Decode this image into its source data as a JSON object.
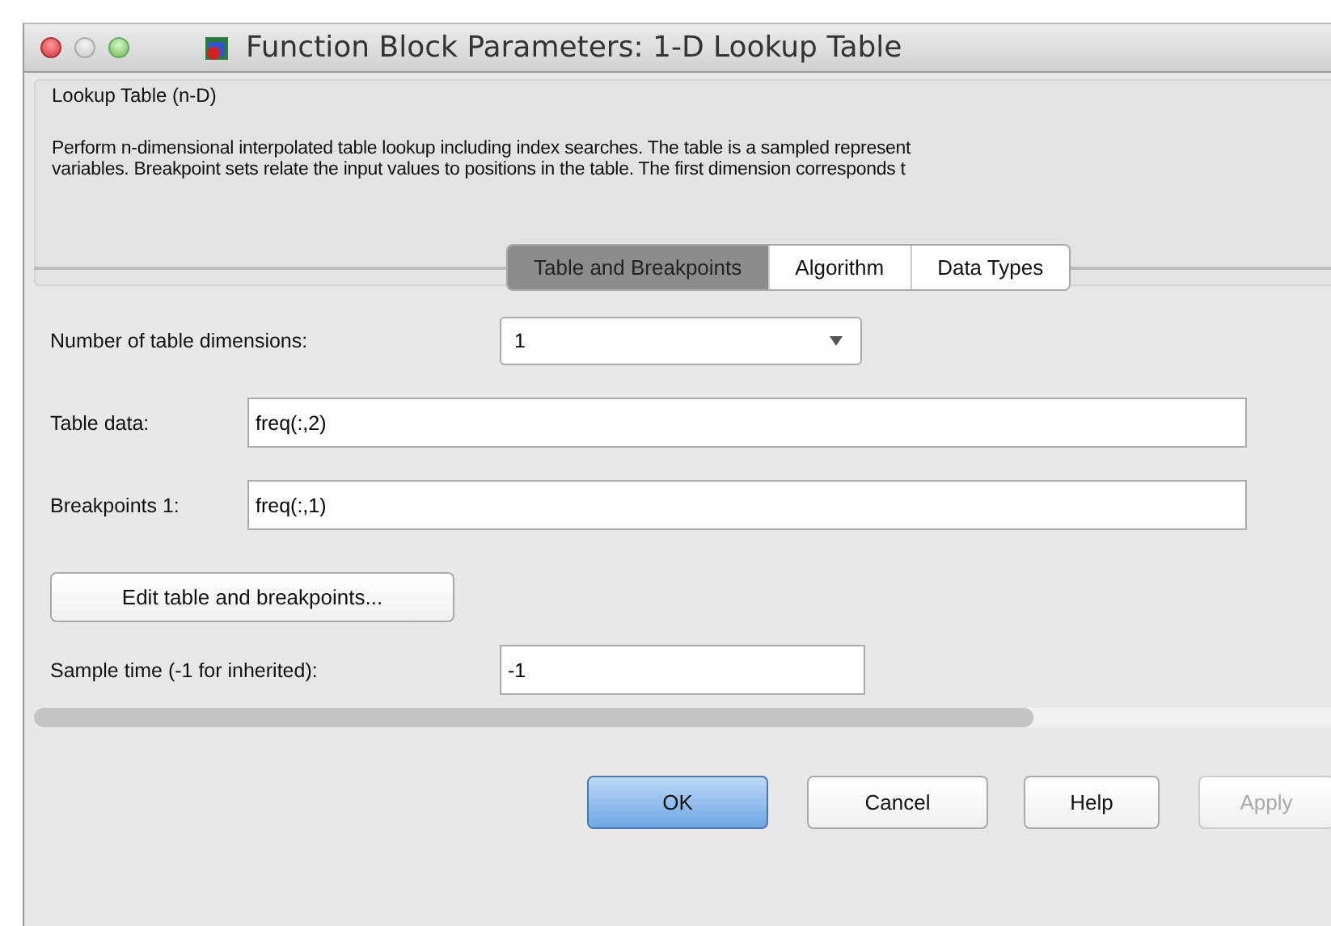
{
  "window": {
    "title": "Function Block Parameters: 1-D Lookup Table"
  },
  "group": {
    "title": "Lookup Table (n-D)",
    "description": [
      "Perform n-dimensional interpolated table lookup including index searches. The table is a sampled represent",
      "variables. Breakpoint sets relate the input values to positions in the table. The first dimension corresponds t"
    ]
  },
  "tabs": [
    {
      "label": "Table and Breakpoints",
      "selected": true
    },
    {
      "label": "Algorithm",
      "selected": false
    },
    {
      "label": "Data Types",
      "selected": false
    }
  ],
  "params": [
    {
      "kind": "dropdown",
      "label": "Number of table dimensions:",
      "value": "1"
    },
    {
      "kind": "text",
      "label": "Table data:",
      "value": "freq(:,2)"
    },
    {
      "kind": "text",
      "label": "Breakpoints 1:",
      "value": "freq(:,1)"
    },
    {
      "kind": "button",
      "label": "Edit table and breakpoints..."
    },
    {
      "kind": "short",
      "label": "Sample time (-1 for inherited):",
      "value": "-1"
    }
  ],
  "buttons": [
    {
      "label": "OK",
      "default": true,
      "disabled": false
    },
    {
      "label": "Cancel",
      "default": false,
      "disabled": false
    },
    {
      "label": "Help",
      "default": false,
      "disabled": false
    },
    {
      "label": "Apply",
      "default": false,
      "disabled": true
    }
  ]
}
